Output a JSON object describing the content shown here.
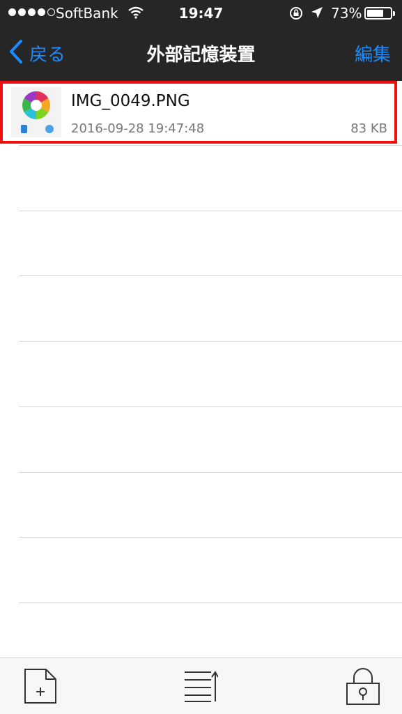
{
  "status_bar": {
    "carrier": "SoftBank",
    "time": "19:47",
    "battery_percent": "73%",
    "battery_level": 0.73,
    "signal_bars_filled": 4,
    "signal_bars_total": 5
  },
  "nav": {
    "back_label": "戻る",
    "title": "外部記憶装置",
    "edit_label": "編集"
  },
  "files": [
    {
      "name": "IMG_0049.PNG",
      "date": "2016-09-28 19:47:48",
      "size": "83 KB",
      "icon": "image-thumbnail"
    }
  ],
  "toolbar": {
    "items": [
      "new-file-icon",
      "sort-list-icon",
      "lock-icon"
    ]
  },
  "colors": {
    "accent": "#1a8cff",
    "nav_background": "#262626",
    "highlight_border": "#f00e0e"
  }
}
